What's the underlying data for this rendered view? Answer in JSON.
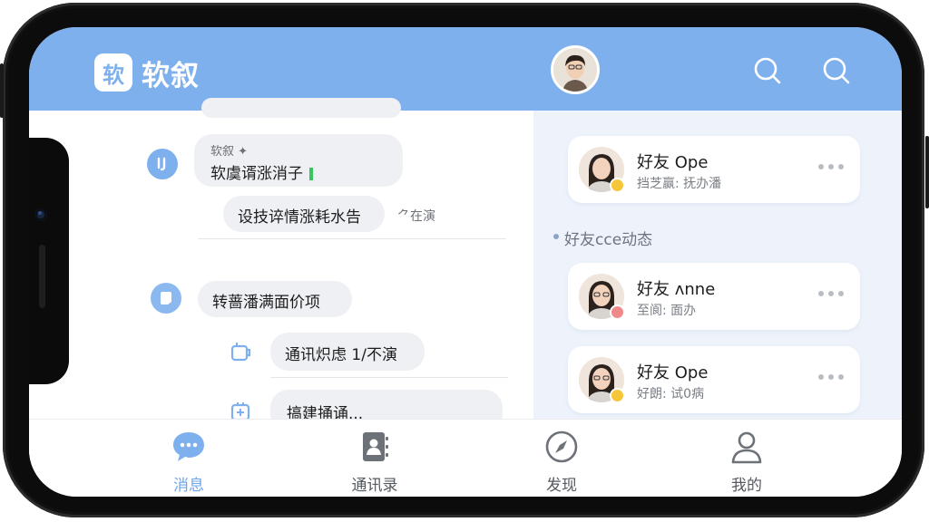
{
  "app": {
    "logo_char": "软",
    "title": "软叙"
  },
  "header": {
    "icons": [
      "search-icon",
      "search-icon"
    ]
  },
  "chat": {
    "bubble1": {
      "sender": "软叙 ✦",
      "text": "软虞谞涨消子"
    },
    "bubble2": {
      "text": "设技谇情涨耗水告"
    },
    "side_label": "⺈在演",
    "bubble3": {
      "text": "转蔷潘满面价项"
    },
    "bubble4": {
      "text": "通讯炽虑 1/不演"
    },
    "bubble5": {
      "text": "搞建捅诵..."
    }
  },
  "right": {
    "card1": {
      "name": "好友 Ope",
      "sub": "挡芝赢: 抚办潘",
      "status_color": "#f5c53a"
    },
    "section_title": "好友ссе动态",
    "card2": {
      "name": "好友 ʌnne",
      "sub": "至阆: 面办",
      "status_color": "#f08a8a"
    },
    "card3": {
      "name": "好友 Ope",
      "sub": "好朗: 试0病",
      "status_color": "#f5c53a"
    }
  },
  "tabs": [
    {
      "label": "消息",
      "icon": "chat-bubble-icon",
      "active": true
    },
    {
      "label": "通讯录",
      "icon": "contacts-icon",
      "active": false
    },
    {
      "label": "发现",
      "icon": "compass-icon",
      "active": false
    },
    {
      "label": "我的",
      "icon": "person-icon",
      "active": false
    }
  ],
  "colors": {
    "accent": "#7fb0ee",
    "active_tab": "#6fa4e8"
  }
}
